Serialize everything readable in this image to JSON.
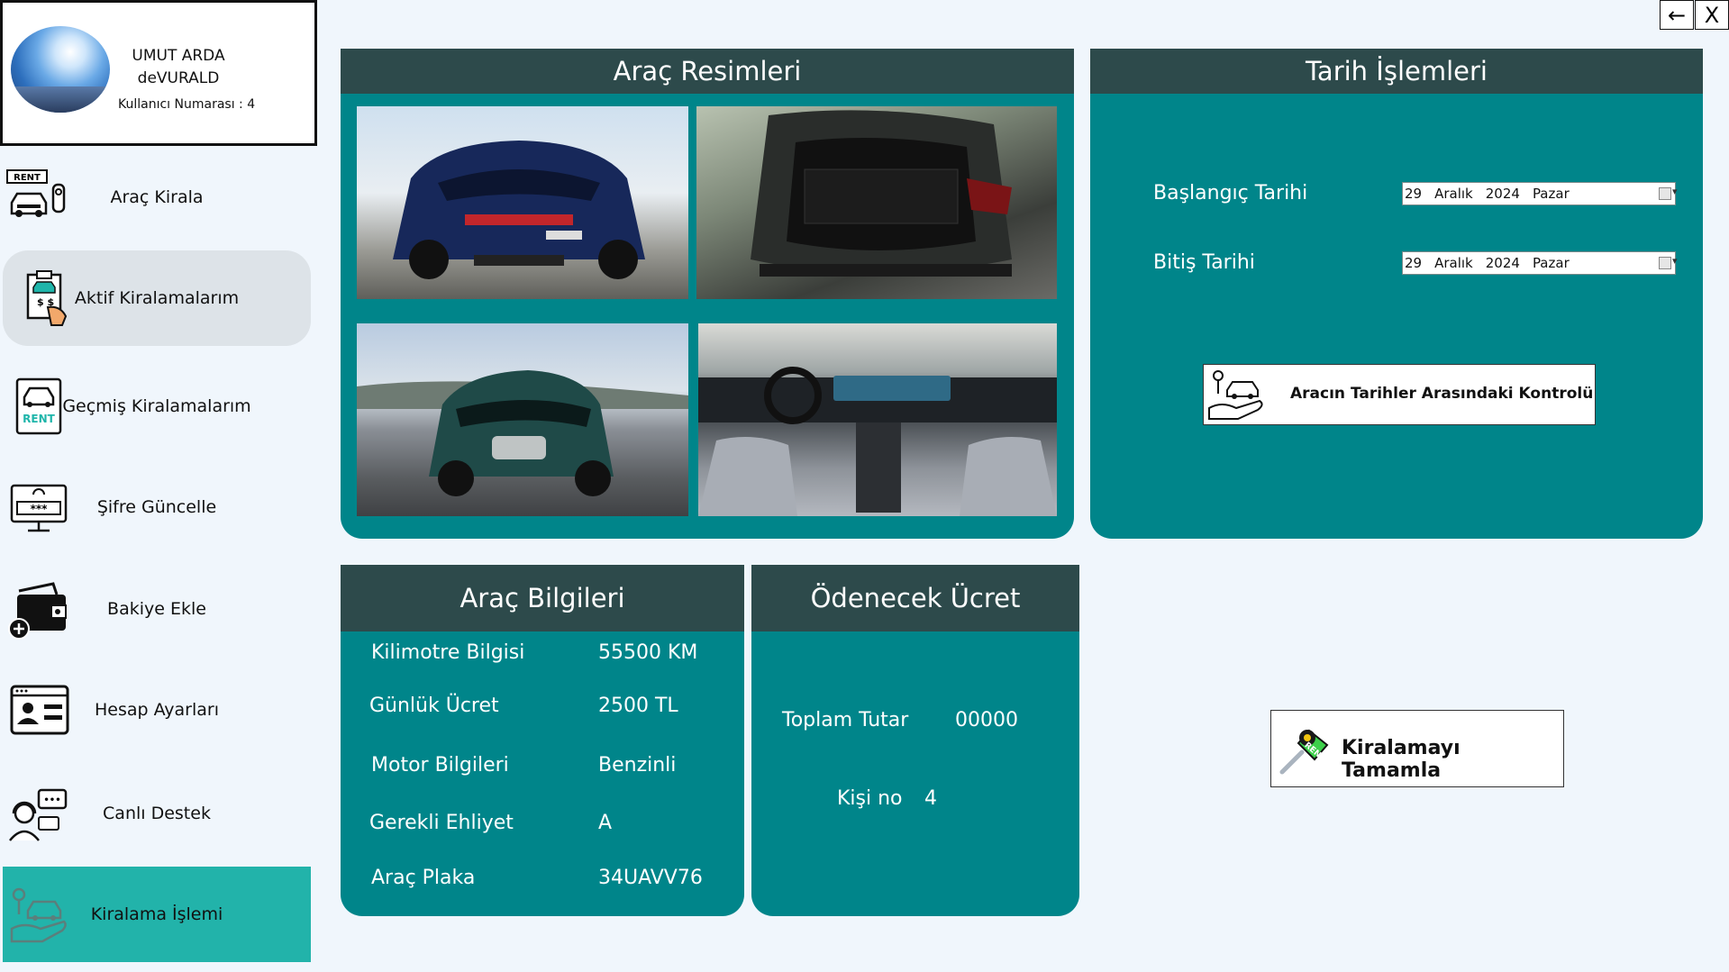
{
  "window_controls": {
    "back_label": "←",
    "close_label": "X"
  },
  "user": {
    "name_line1": "UMUT ARDA",
    "name_line2": "deVURALD",
    "id_text": "Kullanıcı Numarası : 4"
  },
  "sidebar": {
    "items": [
      {
        "label": "Araç Kirala",
        "icon": "car-rent-key-icon"
      },
      {
        "label": "Aktif Kiralamalarım",
        "icon": "rental-document-icon"
      },
      {
        "label": "Geçmiş Kiralamalarım",
        "icon": "rent-book-icon"
      },
      {
        "label": "Şifre Güncelle",
        "icon": "password-monitor-icon"
      },
      {
        "label": "Bakiye Ekle",
        "icon": "wallet-add-icon"
      },
      {
        "label": "Hesap Ayarları",
        "icon": "account-card-icon"
      },
      {
        "label": "Canlı Destek",
        "icon": "live-support-icon"
      },
      {
        "label": "Kiralama İşlemi",
        "icon": "rental-hand-car-icon"
      }
    ]
  },
  "photos_panel": {
    "title": "Araç Resimleri"
  },
  "date_panel": {
    "title": "Tarih İşlemleri",
    "start_label": "Başlangıç Tarihi",
    "end_label": "Bitiş Tarihi",
    "start_date": {
      "day": "29",
      "month": "Aralık",
      "year": "2024",
      "weekday": "Pazar"
    },
    "end_date": {
      "day": "29",
      "month": "Aralık",
      "year": "2024",
      "weekday": "Pazar"
    },
    "check_button_label": "Aracın Tarihler Arasındaki Kontrolü"
  },
  "vehicle_info": {
    "title": "Araç Bilgileri",
    "rows": [
      {
        "label": "Kilimotre Bilgisi",
        "value": "55500 KM"
      },
      {
        "label": "Günlük Ücret",
        "value": "2500 TL"
      },
      {
        "label": "Motor Bilgileri",
        "value": "Benzinli"
      },
      {
        "label": "Gerekli Ehliyet",
        "value": "A"
      },
      {
        "label": "Araç Plaka",
        "value": "34UAVV76"
      }
    ]
  },
  "payment": {
    "title": "Ödenecek Ücret",
    "total_label": "Toplam Tutar",
    "total_value": "00000",
    "person_label": "Kişi no",
    "person_value": "4"
  },
  "complete_button_label": "Kiralamayı Tamamla",
  "colors": {
    "teal": "#00858a",
    "header": "#2d4a4b",
    "active_teal": "#22b3aa",
    "active_gray": "#dde3e8",
    "background": "#f0f6fc"
  }
}
